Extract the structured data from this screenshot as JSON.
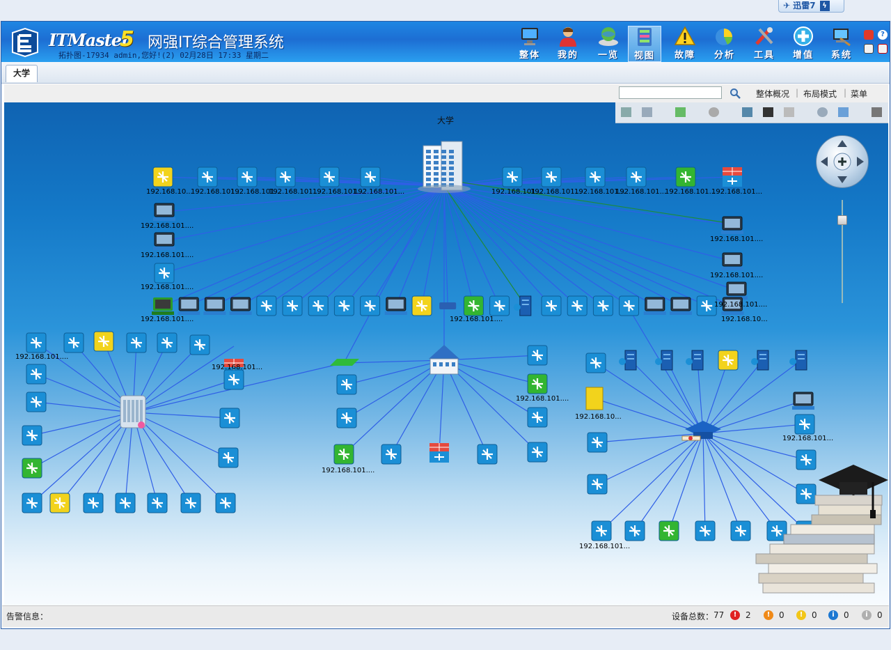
{
  "browser_badge": {
    "label": "迅雷7",
    "bolt": "ϟ"
  },
  "header": {
    "brand": "ITMaster",
    "brand_version": "5",
    "system_title": "网强IT综合管理系统",
    "user_info": "拓扑图-17934 admin,您好!(2) 02月28日 17:33 星期二"
  },
  "nav": [
    {
      "label": "整体",
      "icon": "monitor-icon"
    },
    {
      "label": "我的",
      "icon": "user-icon"
    },
    {
      "label": "一览",
      "icon": "globe-icon"
    },
    {
      "label": "视图",
      "icon": "topology-view-icon",
      "active": true
    },
    {
      "label": "故障",
      "icon": "warning-icon"
    },
    {
      "label": "分析",
      "icon": "pie-chart-icon"
    },
    {
      "label": "工具",
      "icon": "tools-icon"
    },
    {
      "label": "增值",
      "icon": "plus-circle-icon"
    },
    {
      "label": "系统",
      "icon": "system-settings-icon"
    }
  ],
  "tabs": [
    {
      "label": "大学"
    }
  ],
  "toolbar": {
    "search_placeholder": "",
    "links": [
      "整体概况",
      "布局模式",
      "菜单"
    ],
    "separators": [
      "|",
      "|"
    ]
  },
  "canvas": {
    "title": "大学"
  },
  "status": {
    "alarm_label": "告警信息：",
    "device_total_label": "设备总数：",
    "device_total": "77",
    "counts": [
      {
        "name": "critical",
        "color": "#e02020",
        "glyph": "!",
        "value": "2"
      },
      {
        "name": "major",
        "color": "#f08a18",
        "glyph": "!",
        "value": "0"
      },
      {
        "name": "minor",
        "color": "#f2c618",
        "glyph": "!",
        "value": "0"
      },
      {
        "name": "info",
        "color": "#1c78d2",
        "glyph": "i",
        "value": "0"
      },
      {
        "name": "unknown",
        "color": "#b0b0b0",
        "glyph": "i",
        "value": "0"
      }
    ]
  },
  "colors": {
    "link": "#2f5fe6",
    "link_alt": "#1f8a3a",
    "switch_blue": "#1b8fd6",
    "alarm_yellow": "#f2d31c",
    "alarm_green": "#33b531"
  },
  "topology": {
    "labels": [
      "192.168.10...",
      "192.168.101...",
      "192.168.101...",
      "192.168.101...",
      "192.168.101...",
      "192.168.101...",
      "192.168.101...",
      "192.168.101...",
      "192.168.101...",
      "192.168.101...",
      "192.168.101...",
      "192.168.101...",
      "192.168.101....",
      "192.168.101....",
      "192.168.101....",
      "192.168.101....",
      "192.168.101....",
      "192.168.101....",
      "192.168.101....",
      "192.168.101....",
      "192.168.10...",
      "192.168.101....",
      "192.168.101...",
      "192.168.101....",
      "192.168.101....",
      "192.168.10...",
      "192.168.101...",
      "192.168.101...",
      "192.168.101....",
      "192.168.10...",
      "192.168.101....",
      "192.168.101....",
      "192.168.101...",
      "192.168.101...",
      "192.168.101..."
    ]
  }
}
